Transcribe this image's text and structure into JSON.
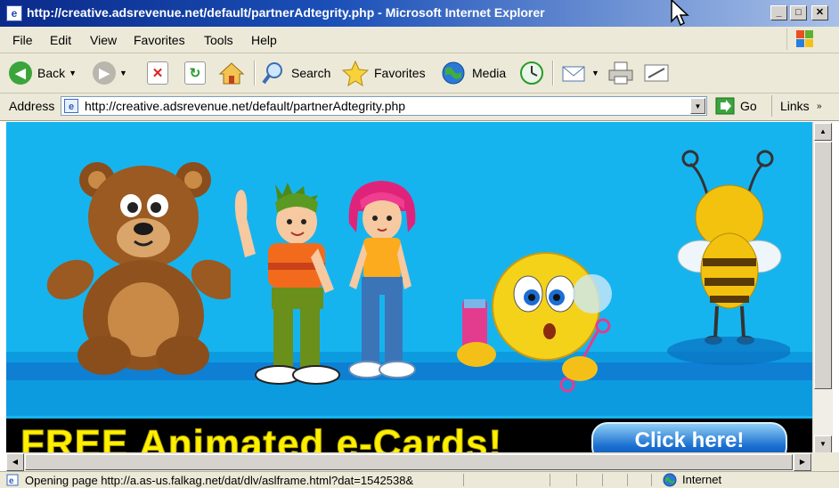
{
  "window": {
    "title": "http://creative.adsrevenue.net/default/partnerAdtegrity.php - Microsoft Internet Explorer",
    "minimize": "_",
    "maximize": "□",
    "close": "✕"
  },
  "menu": [
    "File",
    "Edit",
    "View",
    "Favorites",
    "Tools",
    "Help"
  ],
  "toolbar": {
    "back": "Back",
    "search": "Search",
    "favorites": "Favorites",
    "media": "Media"
  },
  "address": {
    "label": "Address",
    "url": "http://creative.adsrevenue.net/default/partnerAdtegrity.php",
    "go": "Go",
    "links": "Links"
  },
  "ad": {
    "headline": "FREE Animated e-Cards!",
    "button": "Click here!"
  },
  "status": {
    "text": "Opening page http://a.as-us.falkag.net/dat/dlv/aslframe.html?dat=1542538&",
    "zone": "Internet"
  },
  "colors": {
    "ad_background": "#16b4ef",
    "headline": "#fff000",
    "title_bar": "#1b50b8"
  }
}
